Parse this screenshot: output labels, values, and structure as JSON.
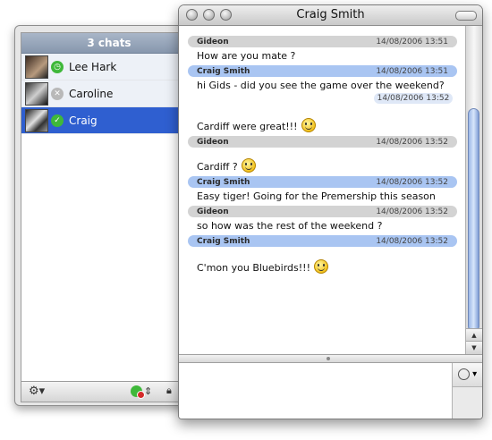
{
  "chat_list": {
    "header": "3 chats",
    "contacts": [
      {
        "name": "Lee Hark",
        "status": "online-idle"
      },
      {
        "name": "Caroline",
        "status": "offline"
      },
      {
        "name": "Craig",
        "status": "online-selected"
      }
    ]
  },
  "conversation": {
    "title": "Craig Smith",
    "messages": [
      {
        "sender": "Gideon",
        "date": "14/08/2006 13:51",
        "text": "How are you mate ?"
      },
      {
        "sender": "Craig Smith",
        "date": "14/08/2006 13:51",
        "text": "hi Gids - did you see the game over the weekend?"
      },
      {
        "extra_time": "14/08/2006 13:52",
        "text": "Cardiff were great!!!"
      },
      {
        "sender": "Gideon",
        "date": "14/08/2006 13:52",
        "text": "Cardiff ?"
      },
      {
        "sender": "Craig Smith",
        "date": "14/08/2006 13:52",
        "text": "Easy tiger! Going for the Premership this season"
      },
      {
        "sender": "Gideon",
        "date": "14/08/2006 13:52",
        "text": "so how was the rest of the weekend ?"
      },
      {
        "sender": "Craig Smith",
        "date": "14/08/2006 13:52",
        "text": "C'mon you Bluebirds!!!"
      }
    ]
  },
  "icons": {
    "gear": "gear-icon",
    "lock": "lock-icon",
    "emoticon": "smiley-icon"
  },
  "colors": {
    "selected_row": "#2f5fd0",
    "craig_header": "#a9c5f2",
    "gideon_header": "#d3d3d3",
    "online": "#3fb83a"
  }
}
